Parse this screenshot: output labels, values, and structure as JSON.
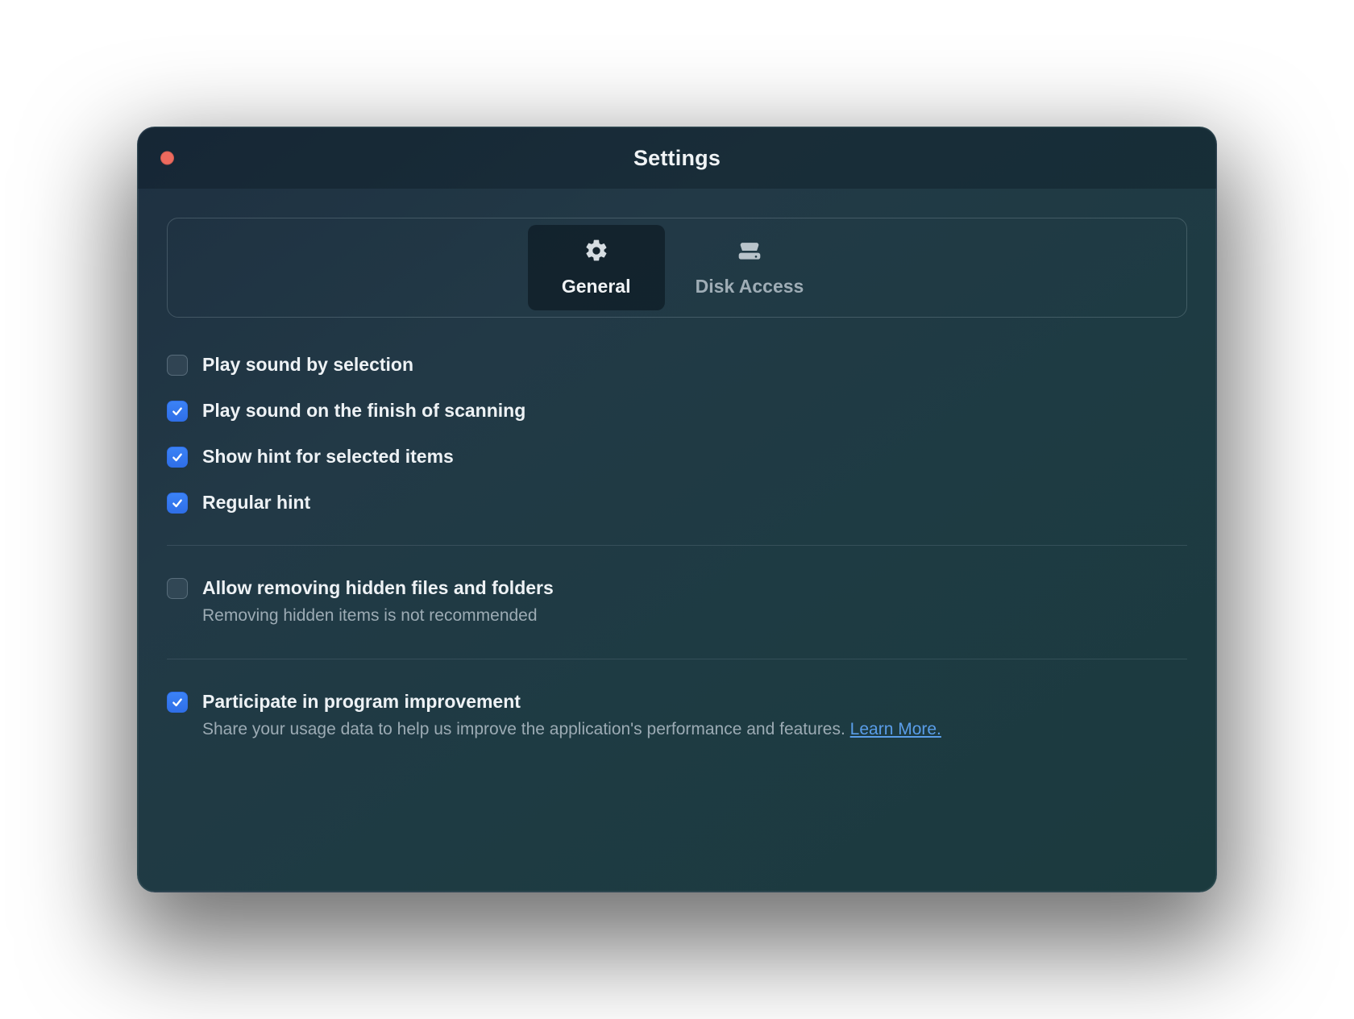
{
  "window": {
    "title": "Settings"
  },
  "tabs": {
    "general": {
      "label": "General"
    },
    "disk_access": {
      "label": "Disk Access"
    }
  },
  "options": {
    "play_sound_selection": {
      "label": "Play sound by selection",
      "checked": false
    },
    "play_sound_finish": {
      "label": "Play sound on the finish of scanning",
      "checked": true
    },
    "show_hint_selected": {
      "label": "Show hint for selected items",
      "checked": true
    },
    "regular_hint": {
      "label": "Regular hint",
      "checked": true
    },
    "allow_remove_hidden": {
      "label": "Allow removing hidden files and folders",
      "sub": "Removing hidden items is not recommended",
      "checked": false
    },
    "program_improvement": {
      "label": "Participate in program improvement",
      "sub": "Share your usage data to help us improve the application's performance and features. ",
      "link": "Learn More.",
      "checked": true
    }
  }
}
